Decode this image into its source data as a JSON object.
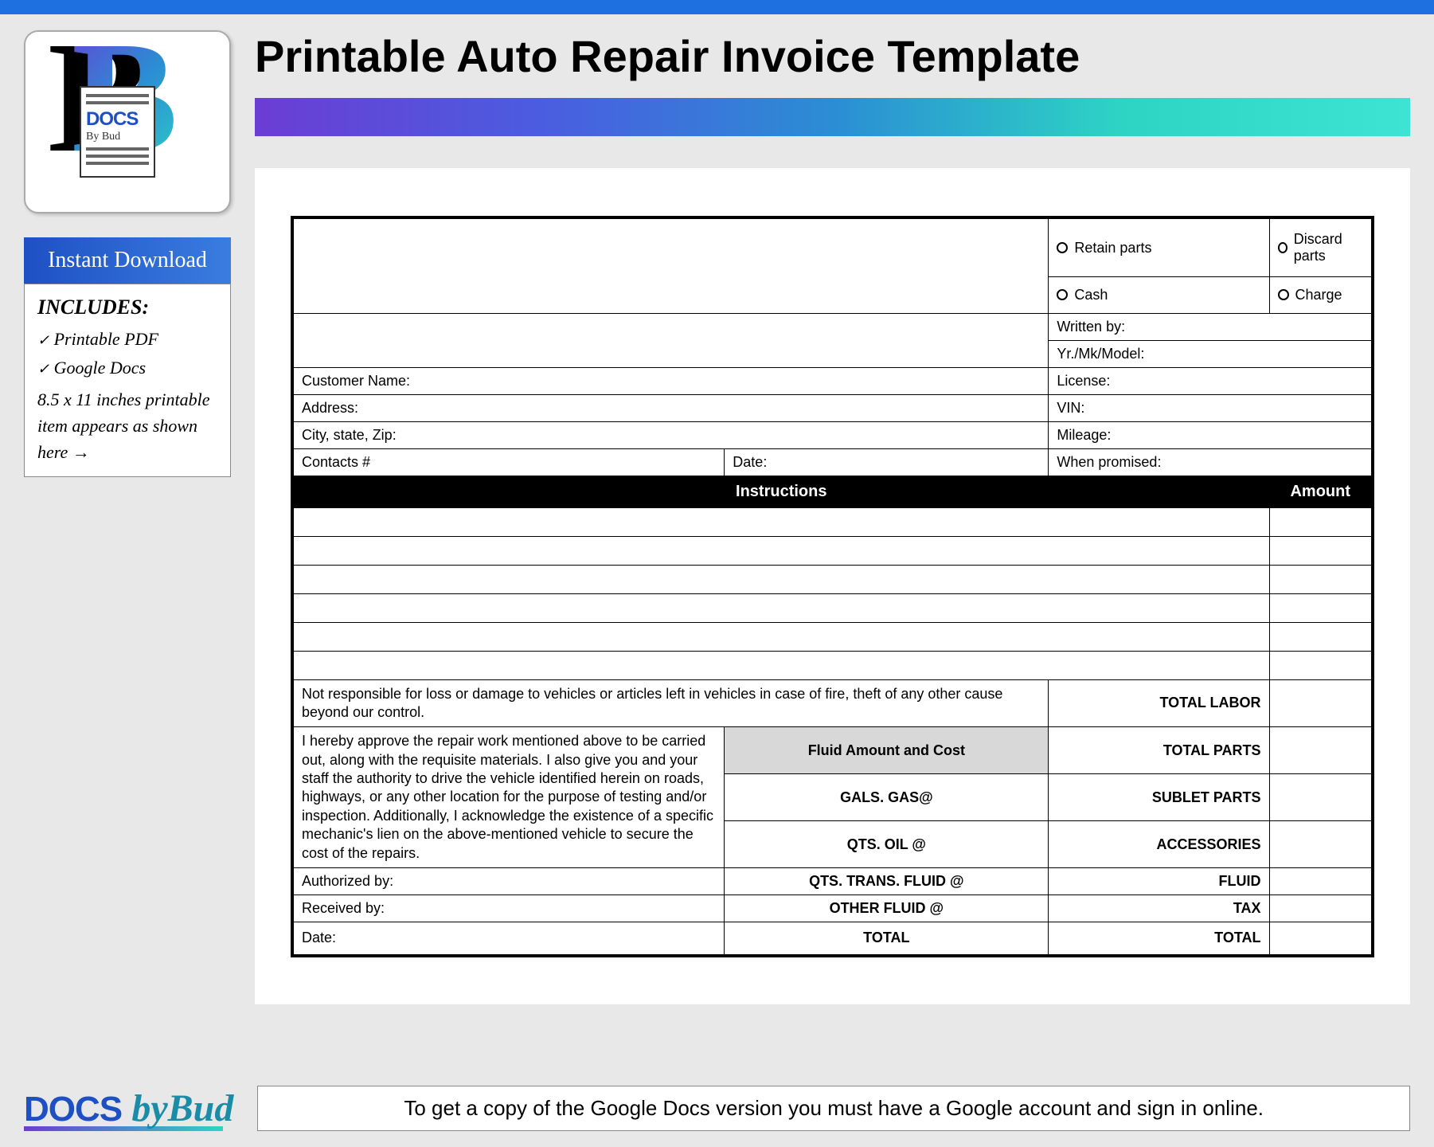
{
  "page_title": "Printable Auto Repair Invoice Template",
  "logo": {
    "docs": "DOCS",
    "bybud": "By Bud"
  },
  "sidebar": {
    "instant_download": "Instant Download",
    "includes_title": "INCLUDES:",
    "item1": "Printable PDF",
    "item2": "Google Docs",
    "description": "8.5 x 11 inches printable item appears as shown here →"
  },
  "invoice": {
    "retain_parts": "Retain parts",
    "discard_parts": "Discard parts",
    "cash": "Cash",
    "charge": "Charge",
    "written_by": "Written by:",
    "yr_mk_model": "Yr./Mk/Model:",
    "customer_name": "Customer Name:",
    "license": "License:",
    "address": "Address:",
    "vin": "VIN:",
    "city_state_zip": "City, state, Zip:",
    "mileage": "Mileage:",
    "contacts": "Contacts #",
    "date": "Date:",
    "when_promised": "When promised:",
    "instructions_header": "Instructions",
    "amount_header": "Amount",
    "disclaimer": "Not responsible for loss or damage to vehicles or articles left in vehicles in case of fire, theft of any other cause beyond our control.",
    "approval_text": "I hereby approve the repair work mentioned above to be carried out, along with the requisite materials. I also give you and your staff the authority to drive the vehicle identified herein on roads, highways, or any other location for the purpose of testing and/or inspection. Additionally, I acknowledge the existence of a specific mechanic's lien on the above-mentioned vehicle to secure the cost of the repairs.",
    "authorized_by": "Authorized by:",
    "received_by": "Received by:",
    "date2": "Date:",
    "fluid_header": "Fluid Amount and Cost",
    "gals_gas": "GALS. GAS@",
    "qts_oil": "QTS. OIL @",
    "qts_trans": "QTS. TRANS. FLUID @",
    "other_fluid": "OTHER FLUID @",
    "fluid_total": "TOTAL",
    "total_labor": "TOTAL LABOR",
    "total_parts": "TOTAL PARTS",
    "sublet_parts": "SUBLET PARTS",
    "accessories": "ACCESSORIES",
    "fluid": "FLUID",
    "tax": "TAX",
    "grand_total": "TOTAL"
  },
  "footer": {
    "docs": "DOCS",
    "bybud": "byBud",
    "note": "To get a copy of the Google Docs version you must have a Google account and sign in online."
  }
}
